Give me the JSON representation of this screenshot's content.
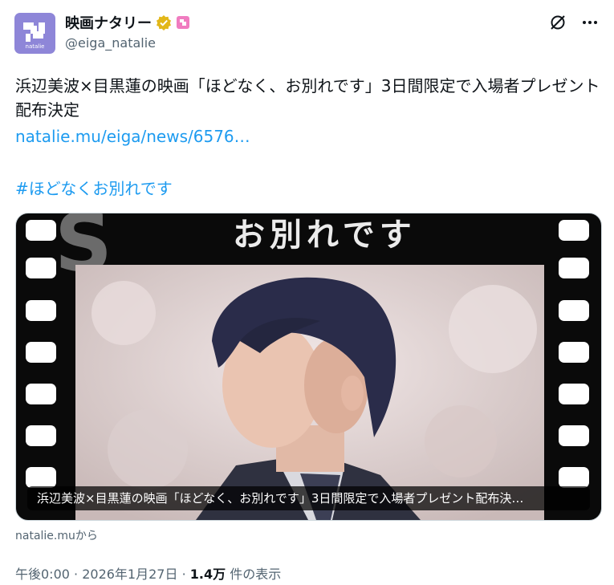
{
  "account": {
    "display_name": "映画ナタリー",
    "handle": "@eiga_natalie",
    "avatar_label": "natalie",
    "verified_color": "#e2b719",
    "affiliate_badge_color": "#e85aad"
  },
  "tweet": {
    "text": "浜辺美波×目黒蓮の映画「ほどなく、お別れです」3日間限定で入場者プレゼント配布決定",
    "link": "natalie.mu/eiga/news/6576…",
    "hashtag": "#ほどなくお別れです"
  },
  "card": {
    "caption": "浜辺美波×目黒蓮の映画「ほどなく、お別れです」3日間限定で入場者プレゼント配布決…",
    "source": "natalie.muから"
  },
  "meta": {
    "time": "午後0:00",
    "date": "2026年1月27日",
    "views_count": "1.4万",
    "views_label": "件の表示"
  },
  "icons": {
    "grok": "grok-icon",
    "more": "more-icon"
  },
  "colors": {
    "accent": "#1d9bf0",
    "text": "#0f1419",
    "secondary": "#536471"
  }
}
